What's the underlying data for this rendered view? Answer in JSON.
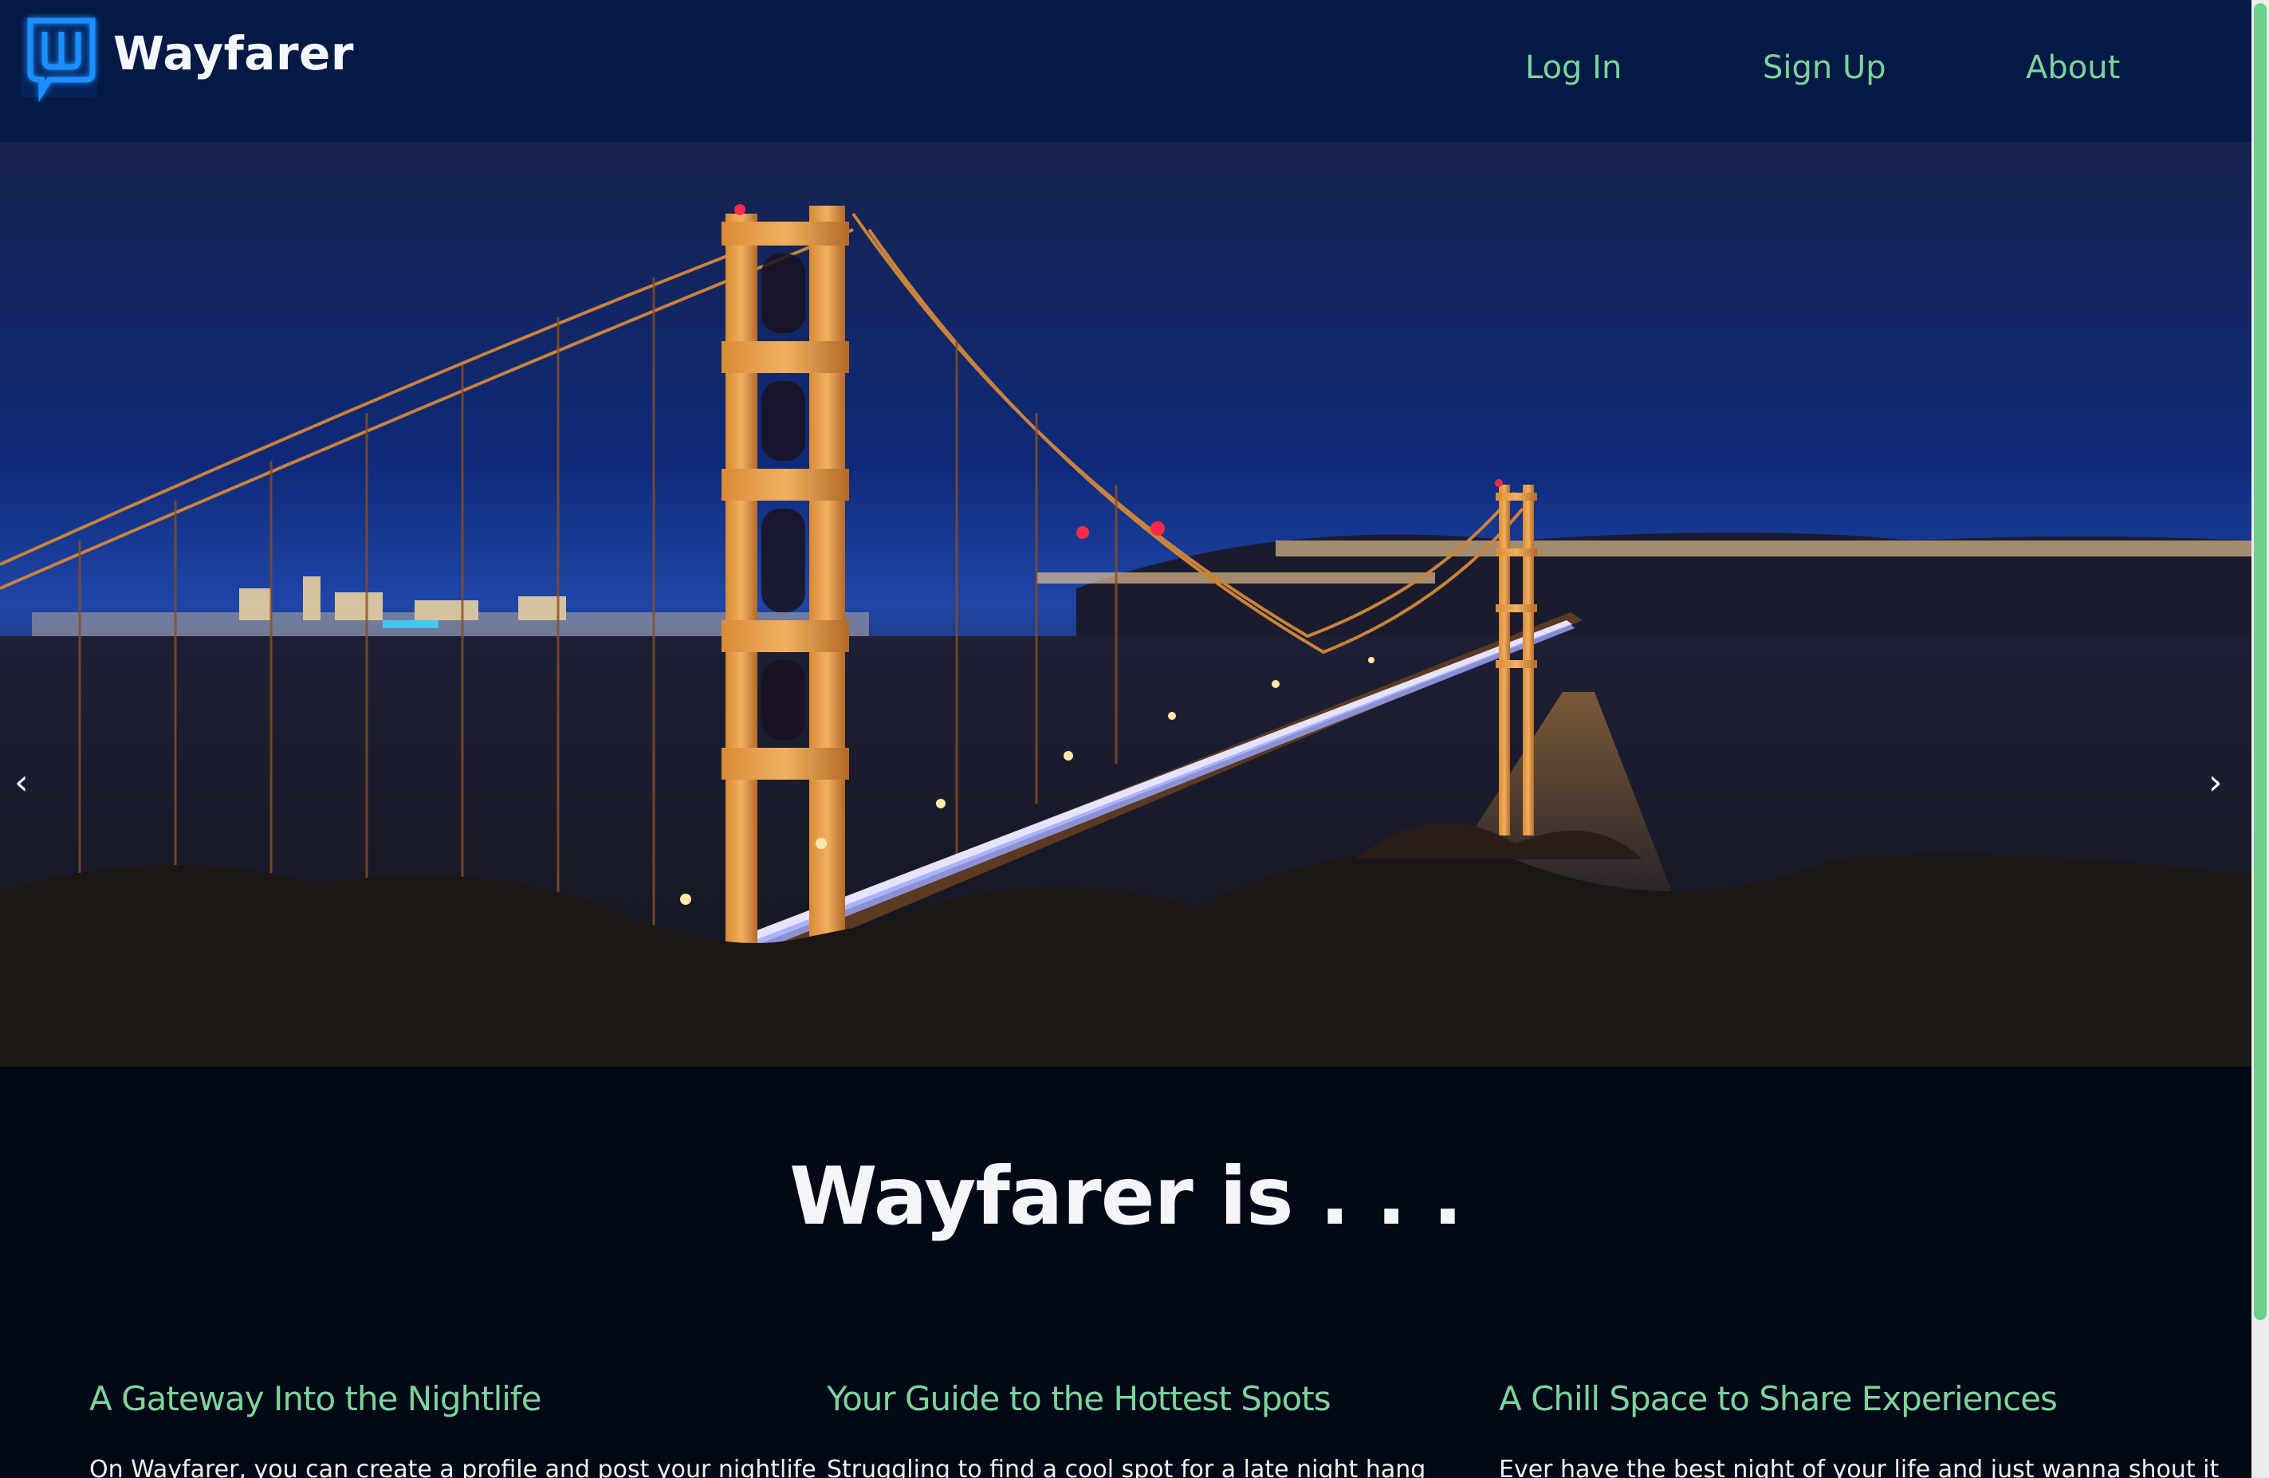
{
  "brand": {
    "name": "Wayfarer",
    "logo_icon": "neon-w-logo-icon"
  },
  "nav": {
    "links": [
      {
        "label": "Log In"
      },
      {
        "label": "Sign Up"
      },
      {
        "label": "About"
      }
    ]
  },
  "carousel": {
    "slide_description_icon": "golden-gate-bridge-night-photo",
    "prev_arrow": "‹",
    "next_arrow": "›"
  },
  "section": {
    "title": "Wayfarer is . . .",
    "features": [
      {
        "title": "A Gateway Into the Nightlife",
        "text": "On Wayfarer, you can create a profile and post your nightlife"
      },
      {
        "title": "Your Guide to the Hottest Spots",
        "text": "Struggling to find a cool spot for a late night hang"
      },
      {
        "title": "A Chill Space to Share Experiences",
        "text": "Ever have the best night of your life and just wanna shout it"
      }
    ]
  },
  "colors": {
    "nav_bg": "#031a45",
    "accent_green": "#7ed39c",
    "page_bg": "#020816",
    "logo_blue": "#1e8fff"
  }
}
